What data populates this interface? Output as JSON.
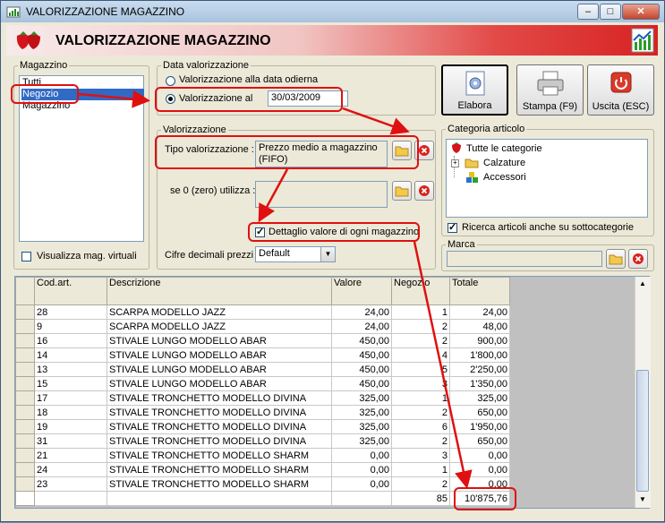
{
  "window": {
    "title": "VALORIZZAZIONE MAGAZZINO",
    "minimize": "–",
    "maximize": "□",
    "close": "✕"
  },
  "header": {
    "title": "VALORIZZAZIONE MAGAZZINO",
    "gradient_color": "#d72222"
  },
  "magazzino": {
    "legend": "Magazzino",
    "items": [
      "Tutti",
      "Negozio",
      "Magazzino"
    ],
    "selected": "Negozio",
    "virtual_label": "Visualizza mag. virtuali"
  },
  "data_valorizzazione": {
    "legend": "Data valorizzazione",
    "option_today": "Valorizzazione alla data odierna",
    "option_date": "Valorizzazione al",
    "date_value": "30/03/2009"
  },
  "valorizzazione": {
    "legend": "Valorizzazione",
    "tipo_label": "Tipo valorizzazione :",
    "tipo_value": "Prezzo medio a magazzino (FIFO)",
    "zero_label": "se 0 (zero) utilizza :",
    "dettaglio_label": "Dettaglio valore di ogni magazzino",
    "decimali_label": "Cifre decimali prezzi :",
    "decimali_value": "Default"
  },
  "toolbar": {
    "elabora": "Elabora",
    "stampa": "Stampa (F9)",
    "uscita": "Uscita (ESC)"
  },
  "categoria": {
    "legend": "Categoria articolo",
    "root": "Tutte le categorie",
    "children": [
      "Calzature",
      "Accessori"
    ],
    "ricerca_label": "Ricerca articoli anche su sottocategorie"
  },
  "marca": {
    "legend": "Marca"
  },
  "grid": {
    "headers": [
      "Cod.art.",
      "Descrizione",
      "Valore",
      "Negozio",
      "Totale"
    ],
    "rows": [
      [
        "28",
        "SCARPA MODELLO JAZZ",
        "24,00",
        "1",
        "24,00"
      ],
      [
        "9",
        "SCARPA MODELLO JAZZ",
        "24,00",
        "2",
        "48,00"
      ],
      [
        "16",
        "STIVALE LUNGO MODELLO ABAR",
        "450,00",
        "2",
        "900,00"
      ],
      [
        "14",
        "STIVALE LUNGO MODELLO ABAR",
        "450,00",
        "4",
        "1'800,00"
      ],
      [
        "13",
        "STIVALE LUNGO MODELLO ABAR",
        "450,00",
        "5",
        "2'250,00"
      ],
      [
        "15",
        "STIVALE LUNGO MODELLO ABAR",
        "450,00",
        "3",
        "1'350,00"
      ],
      [
        "17",
        "STIVALE TRONCHETTO MODELLO DIVINA",
        "325,00",
        "1",
        "325,00"
      ],
      [
        "18",
        "STIVALE TRONCHETTO MODELLO DIVINA",
        "325,00",
        "2",
        "650,00"
      ],
      [
        "19",
        "STIVALE TRONCHETTO MODELLO DIVINA",
        "325,00",
        "6",
        "1'950,00"
      ],
      [
        "31",
        "STIVALE TRONCHETTO MODELLO DIVINA",
        "325,00",
        "2",
        "650,00"
      ],
      [
        "21",
        "STIVALE TRONCHETTO MODELLO SHARM",
        "0,00",
        "3",
        "0,00"
      ],
      [
        "24",
        "STIVALE TRONCHETTO MODELLO SHARM",
        "0,00",
        "1",
        "0,00"
      ],
      [
        "23",
        "STIVALE TRONCHETTO MODELLO SHARM",
        "0,00",
        "2",
        "0,00"
      ]
    ],
    "total_qty": "85",
    "total_value": "10'875,76"
  },
  "colors": {
    "highlight": "#e01010",
    "selection": "#316ac5",
    "total_cell": "#00ffff"
  }
}
